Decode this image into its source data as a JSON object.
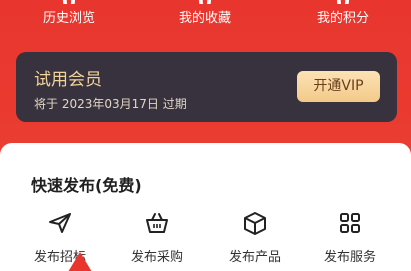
{
  "stats": [
    {
      "label": "历史浏览"
    },
    {
      "label": "我的收藏"
    },
    {
      "label": "我的积分"
    }
  ],
  "member": {
    "title": "试用会员",
    "expiry": "将于 2023年03月17日 过期",
    "vip_button": "开通VIP"
  },
  "quick_publish": {
    "title": "快速发布(免费)",
    "items": [
      {
        "label": "发布招标",
        "icon": "paper-plane-icon"
      },
      {
        "label": "发布采购",
        "icon": "basket-icon"
      },
      {
        "label": "发布产品",
        "icon": "box-icon"
      },
      {
        "label": "发布服务",
        "icon": "grid-icon"
      }
    ]
  },
  "colors": {
    "header_red": "#e8362f",
    "card_dark": "#37323d",
    "gold_text": "#f1d49b",
    "vip_button": "#f3c98a"
  }
}
